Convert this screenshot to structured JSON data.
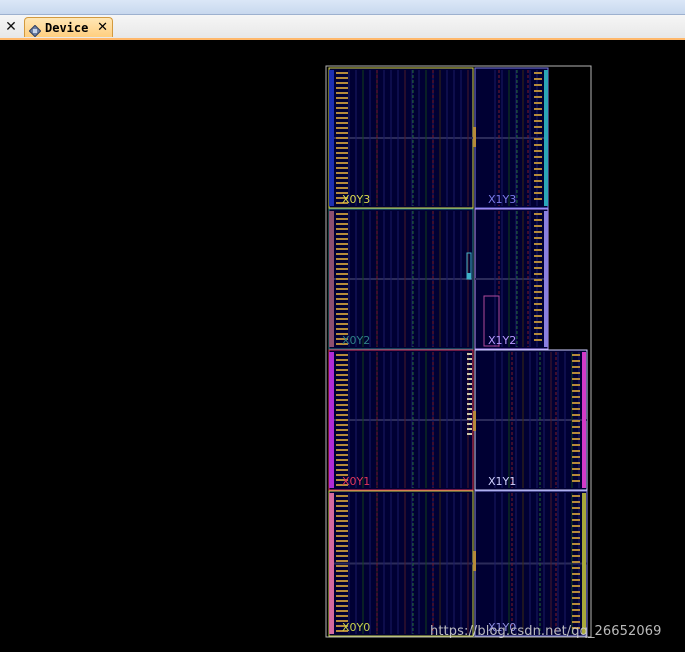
{
  "tab": {
    "label": "Device",
    "icon": "device-chip-icon",
    "close_glyph": "✕"
  },
  "left_close_glyph": "✕",
  "colors": {
    "accent_orange": "#ffb86b",
    "fabric_bg": "#000033",
    "outline": "#b5b5b5"
  },
  "regions": [
    {
      "name": "X0Y3",
      "color": "#d9d84c"
    },
    {
      "name": "X1Y3",
      "color": "#7b7be8"
    },
    {
      "name": "X0Y2",
      "color": "#2d7f86"
    },
    {
      "name": "X1Y2",
      "color": "#b79aff"
    },
    {
      "name": "X0Y1",
      "color": "#e0365a"
    },
    {
      "name": "X1Y1",
      "color": "#cfd0ff"
    },
    {
      "name": "X0Y0",
      "color": "#c8d24a"
    },
    {
      "name": "X1Y0",
      "color": "#8e8ee0"
    }
  ],
  "watermark": "https://blog.csdn.net/qq_26652069"
}
